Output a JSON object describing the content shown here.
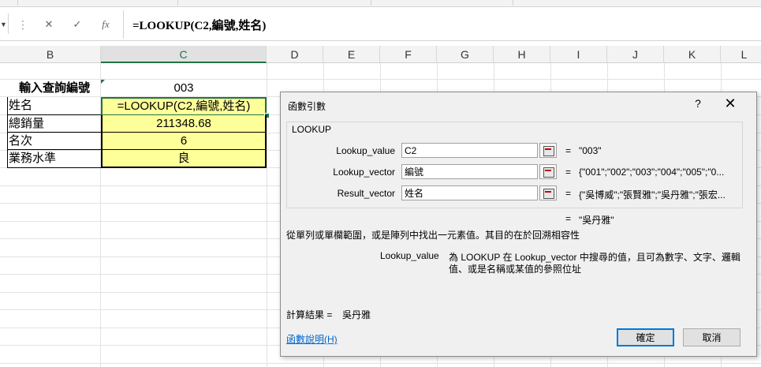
{
  "formula_bar": {
    "cancel_symbol": "✕",
    "enter_symbol": "✓",
    "fx_symbol": "fx",
    "formula": "=LOOKUP(C2,編號,姓名)"
  },
  "columns": [
    "B",
    "C",
    "D",
    "E",
    "F",
    "G",
    "H",
    "I",
    "J",
    "K",
    "L"
  ],
  "sheet": {
    "query_label": "輸入查詢編號",
    "query_value": "003",
    "rows": [
      {
        "label": "姓名",
        "value": "=LOOKUP(C2,編號,姓名)"
      },
      {
        "label": "總銷量",
        "value": "211348.68"
      },
      {
        "label": "名次",
        "value": "6"
      },
      {
        "label": "業務水準",
        "value": "良"
      }
    ]
  },
  "dialog": {
    "title": "函數引數",
    "help": "?",
    "close": "✕",
    "function_name": "LOOKUP",
    "args": [
      {
        "label": "Lookup_value",
        "input": "C2",
        "result": "\"003\""
      },
      {
        "label": "Lookup_vector",
        "input": "編號",
        "result": "{\"001\";\"002\";\"003\";\"004\";\"005\";\"0..."
      },
      {
        "label": "Result_vector",
        "input": "姓名",
        "result": "{\"吳博威\";\"張賢雅\";\"吳丹雅\";\"張宏..."
      }
    ],
    "equals": "=",
    "overall_result": "\"吳丹雅\"",
    "description": "從單列或單欄範圍，或是陣列中找出一元素值。其目的在於回溯相容性",
    "arg_help_name": "Lookup_value",
    "arg_help_text_line1": "為 LOOKUP 在 Lookup_vector 中搜尋的值，且可為數字、文字、邏輯",
    "arg_help_text_line2": "值、或是名稱或某值的參照位址",
    "calc_label": "計算結果 =",
    "calc_value": "吳丹雅",
    "help_link": "函數說明(H)",
    "ok": "確定",
    "cancel": "取消"
  }
}
